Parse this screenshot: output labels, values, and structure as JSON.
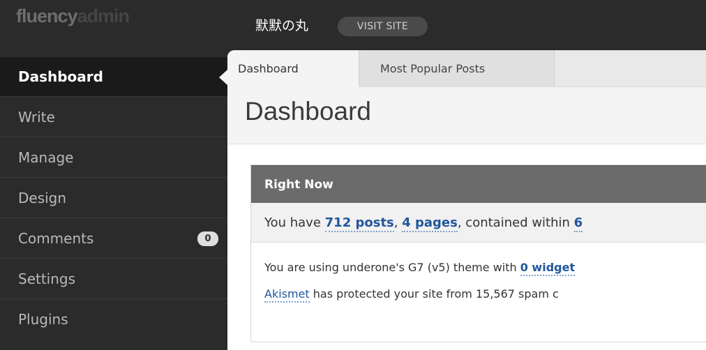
{
  "logo": {
    "part1": "fluency",
    "part2": "admin"
  },
  "site": {
    "name": "默默の丸",
    "visit_label": "VISIT SITE"
  },
  "sidebar": {
    "items": [
      {
        "label": "Dashboard",
        "active": true
      },
      {
        "label": "Write"
      },
      {
        "label": "Manage"
      },
      {
        "label": "Design"
      },
      {
        "label": "Comments",
        "badge": "0"
      },
      {
        "label": "Settings"
      },
      {
        "label": "Plugins"
      }
    ]
  },
  "tabs": [
    {
      "label": "Dashboard",
      "active": true
    },
    {
      "label": "Most Popular Posts"
    }
  ],
  "page": {
    "title": "Dashboard"
  },
  "right_now": {
    "title": "Right Now",
    "summary": {
      "prefix": "You have ",
      "posts": "712 posts",
      "sep": ", ",
      "pages": "4 pages",
      "mid": ", contained within ",
      "count": "6"
    },
    "theme_line": {
      "prefix": "You are using underone's G7 (v5) theme with ",
      "widgets": "0 widget"
    },
    "akismet_line": {
      "link": "Akismet",
      "text": " has protected your site from 15,567 spam c"
    }
  }
}
